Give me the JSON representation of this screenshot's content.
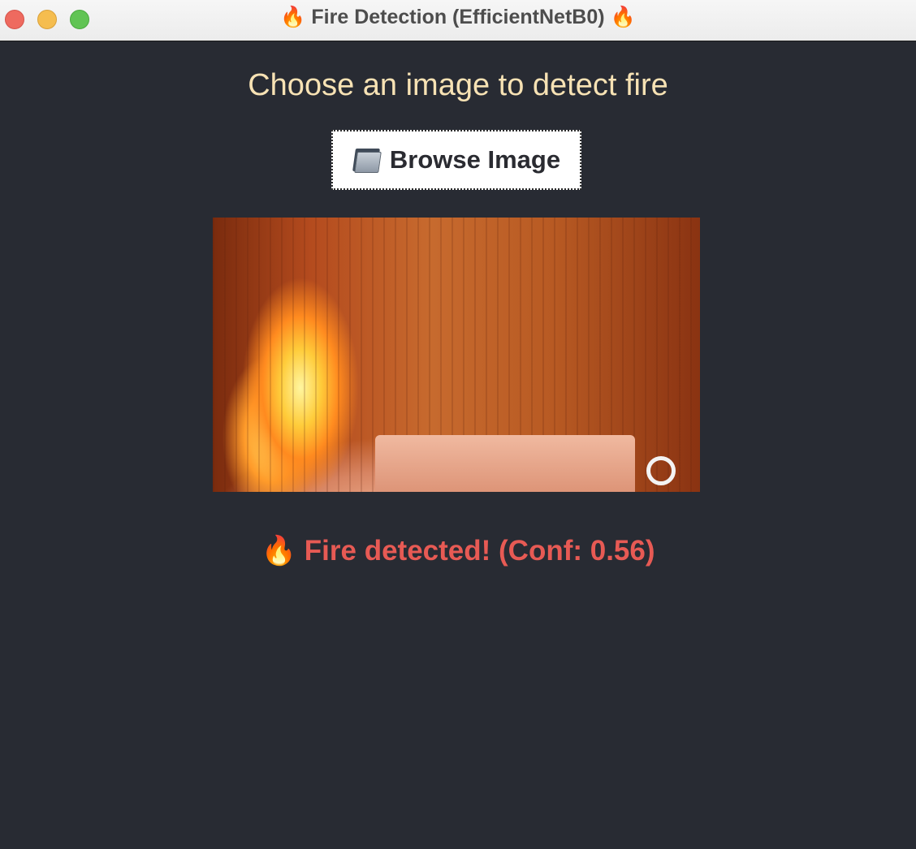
{
  "window": {
    "title": "Fire Detection (EfficientNetB0)",
    "title_icon": "fire-emoji",
    "title_icon_glyph": "🔥"
  },
  "main": {
    "heading": "Choose an image to detect fire",
    "browse_button": {
      "label": "Browse Image",
      "icon": "folder-icon"
    },
    "preview_image": {
      "description_icon": "fire-photo"
    },
    "result": {
      "icon_glyph": "🔥",
      "text": "Fire detected! (Conf: 0.56)"
    }
  },
  "colors": {
    "background": "#282b33",
    "heading": "#f7e2b4",
    "result": "#e75a54",
    "button_background": "#ffffff"
  }
}
